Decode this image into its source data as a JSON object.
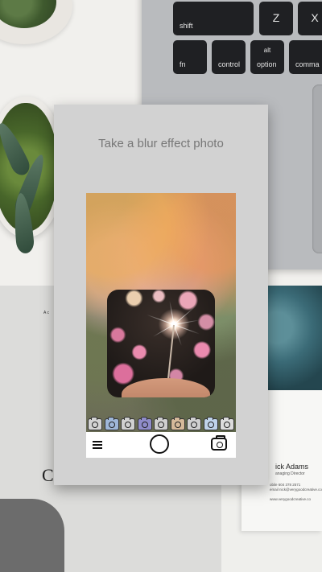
{
  "background": {
    "keyboard_keys": [
      {
        "label": "shift",
        "up": ""
      },
      {
        "label": "",
        "up": "Z"
      },
      {
        "label": "",
        "up": "X"
      },
      {
        "label": "fn",
        "up": ""
      },
      {
        "label": "control",
        "up": ""
      },
      {
        "label": "option",
        "up": "alt"
      },
      {
        "label": "comma",
        "up": ""
      }
    ],
    "paper_text": "A c",
    "paper_big": "C",
    "card": {
      "name": "ick Adams",
      "role": "anaging Director",
      "line1": "obile 604 378 2571",
      "line2": "email nick@verygoodcreative.co",
      "line3": "www.verygoodcreative.co"
    }
  },
  "app": {
    "title": "Take a blur effect photo",
    "filters": [
      {
        "name": "filter-1",
        "color": "#d4d4d4"
      },
      {
        "name": "filter-2",
        "color": "#9fb7d8"
      },
      {
        "name": "filter-3",
        "color": "#d0d0d0"
      },
      {
        "name": "filter-4",
        "color": "#8f8cc9"
      },
      {
        "name": "filter-5",
        "color": "#cfcfcf"
      },
      {
        "name": "filter-6",
        "color": "#d6b99a"
      },
      {
        "name": "filter-7",
        "color": "#d0d0d0"
      },
      {
        "name": "filter-8",
        "color": "#bfd3ea"
      },
      {
        "name": "filter-9",
        "color": "#dcdcdc"
      }
    ],
    "toolbar": {
      "menu_icon": "menu-icon",
      "shutter_icon": "shutter-icon",
      "switch_camera_icon": "camera-switch-icon"
    }
  }
}
